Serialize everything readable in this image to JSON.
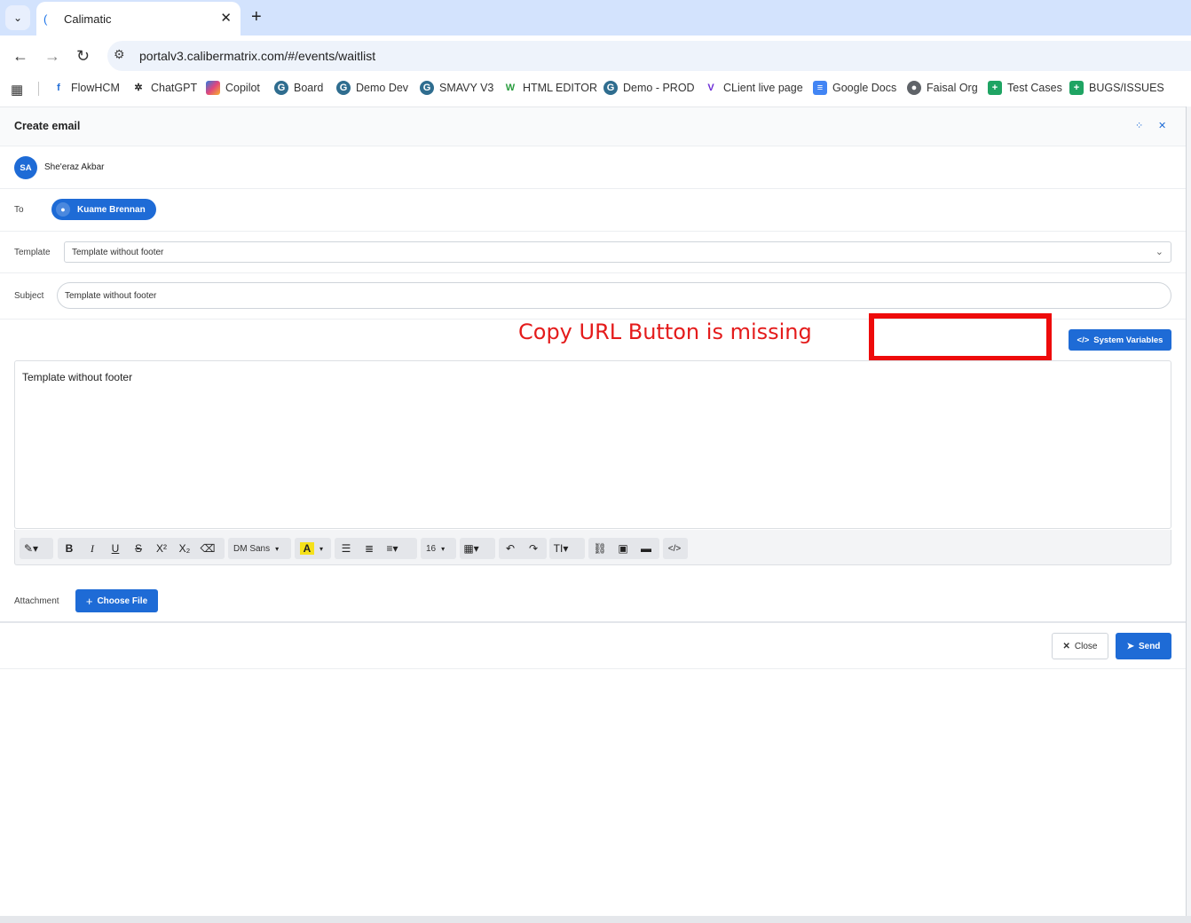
{
  "browser": {
    "tab_title": "Calimatic",
    "url": "portalv3.calibermatrix.com/#/events/waitlist",
    "bookmarks": [
      {
        "label": "FlowHCM",
        "icon": "flowhcm-icon"
      },
      {
        "label": "ChatGPT",
        "icon": "chatgpt-icon"
      },
      {
        "label": "Copilot",
        "icon": "copilot-icon"
      },
      {
        "label": "Board",
        "icon": "board-icon"
      },
      {
        "label": "Demo Dev",
        "icon": "demo-dev-icon"
      },
      {
        "label": "SMAVY V3",
        "icon": "smavy-icon"
      },
      {
        "label": "HTML EDITOR",
        "icon": "html-editor-icon"
      },
      {
        "label": "Demo - PROD",
        "icon": "demo-prod-icon"
      },
      {
        "label": "CLient live page",
        "icon": "client-live-icon"
      },
      {
        "label": "Google Docs",
        "icon": "google-docs-icon"
      },
      {
        "label": "Faisal Org",
        "icon": "faisal-org-icon"
      },
      {
        "label": "Test Cases",
        "icon": "sheets-icon"
      },
      {
        "label": "BUGS/ISSUES",
        "icon": "sheets-icon"
      }
    ]
  },
  "modal": {
    "title": "Create email",
    "sender": {
      "initials": "SA",
      "name": "She'eraz Akbar"
    },
    "to": {
      "label": "To",
      "recipient": "Kuame Brennan"
    },
    "template": {
      "label": "Template",
      "value": "Template without footer"
    },
    "subject": {
      "label": "Subject",
      "value": "Template without footer"
    },
    "annotation": "Copy URL Button is missing",
    "system_variables_label": "System Variables",
    "editor_body": "Template without footer",
    "toolbar": {
      "font": "DM Sans",
      "font_size": "16"
    },
    "attachment": {
      "label": "Attachment",
      "button": "Choose File"
    },
    "footer": {
      "close": "Close",
      "send": "Send"
    }
  },
  "colors": {
    "primary": "#1e6bd6",
    "annotation_red": "#e41b1b"
  }
}
